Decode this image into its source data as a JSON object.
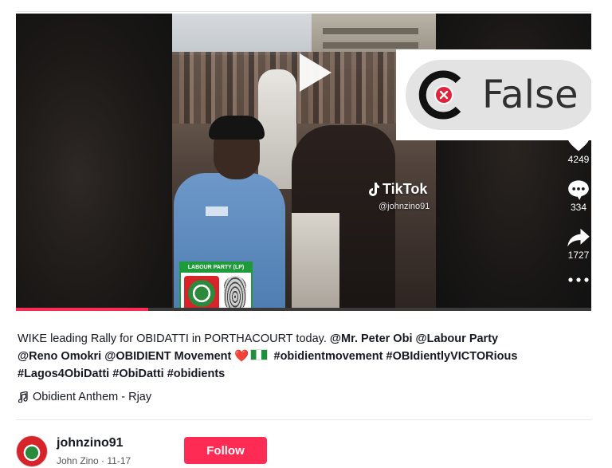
{
  "video": {
    "tiktok_brand": "TikTok",
    "tiktok_handle": "@johnzino91",
    "logo_title": "LABOUR PARTY (LP)",
    "progress": 0.23,
    "verdict": "False",
    "verdict_icon": "factcheck-x-icon"
  },
  "actions": {
    "likes": "4249",
    "comments": "334",
    "shares": "1727"
  },
  "caption": {
    "text": "WIKE leading Rally for OBIDATTI in PORTHACOURT today.",
    "mention1": "@Mr. Peter Obi",
    "mention2": "@Labour Party",
    "mention3": "@Reno Omokri",
    "mention4": "@OBIDIENT Movement",
    "heart": "❤️",
    "tag1": "#obidientmovement",
    "tag2": "#OBIdientlyVICTORious",
    "tag3": "#Lagos4ObiDatti",
    "tag4": "#ObiDatti",
    "tag5": "#obidients"
  },
  "music": {
    "title": "Obidient Anthem - Rjay"
  },
  "author": {
    "username": "johnzino91",
    "display": "John Zino · 11-17",
    "follow_label": "Follow"
  },
  "colors": {
    "brand": "#fe2c55",
    "text": "#161823",
    "verdict_red": "#e0243c"
  }
}
